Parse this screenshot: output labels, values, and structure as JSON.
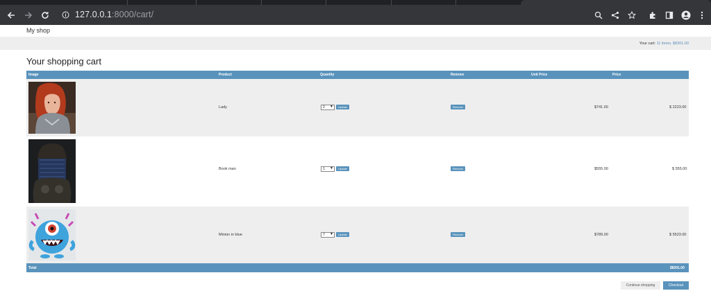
{
  "browser": {
    "url_host": "127.0.0.1",
    "url_path": ":8000/cart/",
    "icons": [
      "back-icon",
      "forward-icon",
      "reload-icon",
      "info-icon",
      "zoom-icon",
      "share-icon",
      "star-icon",
      "extensions-icon",
      "sidepanel-icon",
      "profile-icon",
      "menu-icon"
    ]
  },
  "site": {
    "brand": "My shop",
    "cart_summary_prefix": "Your cart:",
    "cart_summary_link": "11 items, $8301.00"
  },
  "page": {
    "title": "Your shopping cart"
  },
  "table": {
    "headers": {
      "image": "Image",
      "product": "Product",
      "quantity": "Quantity",
      "remove": "Remove",
      "unit_price": "Unit Price",
      "price": "Price"
    },
    "rows": [
      {
        "product": "Lady",
        "quantity": "2",
        "update": "Update",
        "remove": "Remove",
        "unit_price": "$741.00",
        "price": "$ 2223.00",
        "image": "red-haired warrior woman"
      },
      {
        "product": "Book man",
        "quantity": "1",
        "update": "Update",
        "remove": "Remove",
        "unit_price": "$555.00",
        "price": "$ 555.00",
        "image": "dark hooded figure with book"
      },
      {
        "product": "Minion in blue",
        "quantity": "7",
        "update": "Update",
        "remove": "Remove",
        "unit_price": "$789.00",
        "price": "$ 5523.00",
        "image": "blue one-eyed monster"
      }
    ],
    "footer": {
      "label": "Total",
      "total": "$8301.00"
    }
  },
  "actions": {
    "continue": "Continue shopping",
    "checkout": "Checkout"
  },
  "colors": {
    "accent": "#5993bc",
    "stripe": "#eeeeee",
    "chrome": "#35363a"
  }
}
